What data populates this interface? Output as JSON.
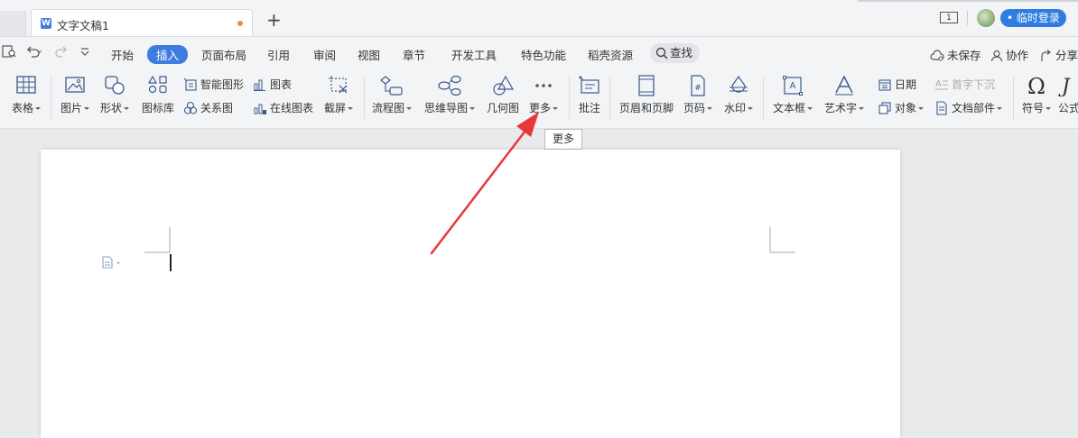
{
  "titlebar": {
    "tab_title": "文字文稿1",
    "tab_icon_letter": "W",
    "new_tab_label": "+",
    "page_count": "1",
    "login_label": "• 临时登录"
  },
  "menubar": {
    "items": [
      "开始",
      "插入",
      "页面布局",
      "引用",
      "审阅",
      "视图",
      "章节",
      "开发工具",
      "特色功能",
      "稻壳资源"
    ],
    "active": "插入",
    "search_label": "查找",
    "unsaved_label": "未保存",
    "collab_label": "协作",
    "share_label": "分享"
  },
  "ribbon": {
    "table": "表格",
    "picture": "图片",
    "shape": "形状",
    "icon_lib": "图标库",
    "smart_shape": "智能图形",
    "relation": "关系图",
    "chart": "图表",
    "online_chart": "在线图表",
    "screenshot": "截屏",
    "flowchart": "流程图",
    "mindmap": "思维导图",
    "geometry": "几何图",
    "more": "更多",
    "comment": "批注",
    "header_footer": "页眉和页脚",
    "page_num": "页码",
    "watermark": "水印",
    "textbox": "文本框",
    "wordart": "艺术字",
    "date": "日期",
    "object": "对象",
    "dropcap": "首字下沉",
    "doc_parts": "文档部件",
    "symbol": "符号",
    "formula": "公式"
  },
  "tooltip": "更多",
  "colors": {
    "accent": "#3e7ce0",
    "login_bg": "#2f7de1",
    "arrow": "#e8373a",
    "unsaved_dot": "#f08c3a"
  }
}
